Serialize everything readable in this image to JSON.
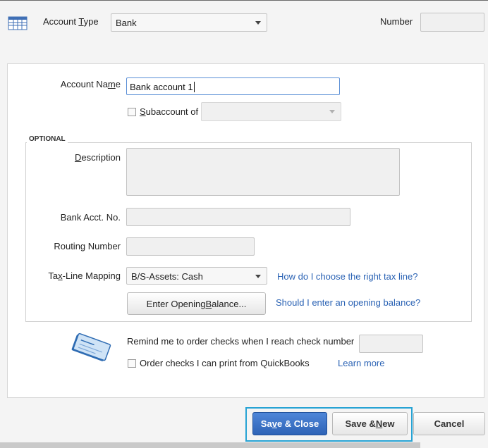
{
  "header": {
    "account_type_label_pre": "Account ",
    "account_type_label_u": "T",
    "account_type_label_post": "ype",
    "account_type_value": "Bank",
    "number_label": "Number",
    "number_value": ""
  },
  "form": {
    "account_name_label_pre": "Account Na",
    "account_name_label_u": "m",
    "account_name_label_post": "e",
    "account_name_value": "Bank account 1",
    "subaccount_label_u": "S",
    "subaccount_label_post": "ubaccount of",
    "subaccount_checked": false,
    "subaccount_value": ""
  },
  "optional": {
    "title": "OPTIONAL",
    "description_label_u": "D",
    "description_label_post": "escription",
    "description_value": "",
    "bank_acct_label": "Bank Acct. No.",
    "bank_acct_value": "",
    "routing_label": "Routing Number",
    "routing_value": "",
    "taxline_label_pre": "Ta",
    "taxline_label_u": "x",
    "taxline_label_post": "-Line Mapping",
    "taxline_value": "B/S-Assets: Cash",
    "taxline_help_link": "How do I choose the right tax line?",
    "opening_balance_pre": "Enter Opening ",
    "opening_balance_u": "B",
    "opening_balance_post": "alance...",
    "opening_balance_help_link": "Should I enter an opening balance?"
  },
  "checks": {
    "remind_label": "Remind me to order checks when I reach check number",
    "remind_value": "",
    "order_label": "Order checks I can print from QuickBooks",
    "order_checked": false,
    "learn_more_link": "Learn more"
  },
  "footer": {
    "save_close_pre": "Sa",
    "save_close_u": "v",
    "save_close_post": "e & Close",
    "save_new_pre": "Save & ",
    "save_new_u": "N",
    "save_new_post": "ew",
    "cancel_label": "Cancel"
  },
  "colors": {
    "accent": "#2e63b6",
    "link": "#2a62b4",
    "focus": "#27a3d4"
  },
  "icons": {
    "header": "account-register-icon",
    "checks": "check-book-icon"
  }
}
